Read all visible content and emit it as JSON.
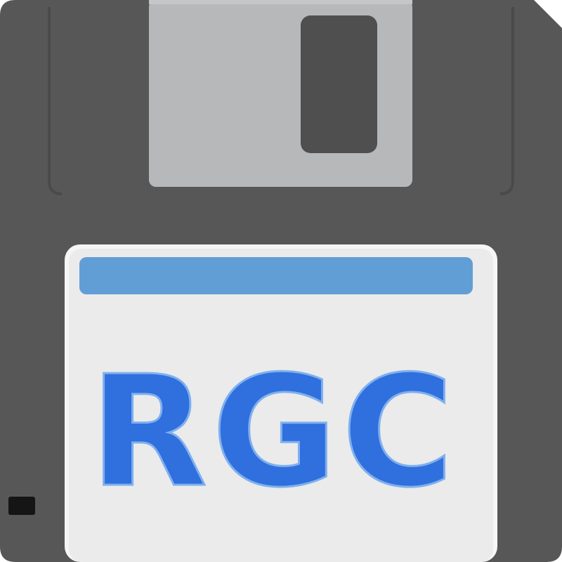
{
  "icon": {
    "name": "floppy-disk-icon",
    "label_text": "RGC",
    "colors": {
      "body": "#575757",
      "body_edge": "#4a4a4a",
      "shutter": "#b6b8b9",
      "shutter_window": "#4f4f4f",
      "label_paper": "#ebebeb",
      "label_border": "#f6f6f6",
      "label_stripe": "#629ed6",
      "text_fill": "#2f6fde",
      "text_outline": "#7fb0ee",
      "write_protect": "#151515"
    }
  }
}
